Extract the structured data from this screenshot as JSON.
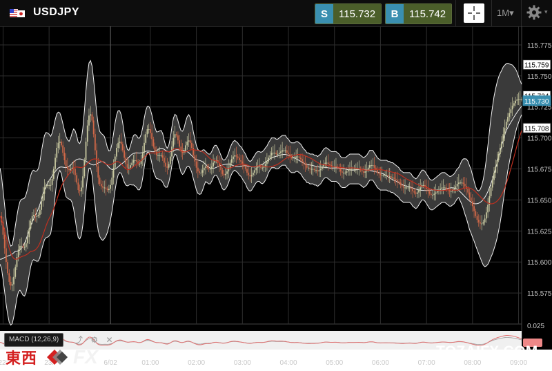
{
  "header": {
    "symbol": "USDJPY",
    "sell": {
      "label": "S",
      "price": "115.732"
    },
    "buy": {
      "label": "B",
      "price": "115.742"
    },
    "timeframe": "1M",
    "timeframe_caret": "▾"
  },
  "macd": {
    "label": "MACD (12,26,9)",
    "tools": [
      "⤴",
      "⚙",
      "✕"
    ],
    "axis_label": "0.025"
  },
  "watermark": {
    "left_cjk": "東西",
    "left_fx": "FX",
    "right": "TOZAIFX.COM"
  },
  "price_tags": [
    {
      "text": "115.759",
      "value": 115.759,
      "style": "white"
    },
    {
      "text": "115.734",
      "value": 115.734,
      "style": "white"
    },
    {
      "text": "115.730",
      "value": 115.73,
      "style": "blue"
    },
    {
      "text": "115.708",
      "value": 115.708,
      "style": "white"
    }
  ],
  "colors": {
    "background": "#000000",
    "grid": "#2e2e2e",
    "band_fill": "#3a3a3a",
    "band_line": "#f2f2f2",
    "candle_up": "#c8c8a0",
    "candle_down": "#d06848",
    "ma_line": "#c03020",
    "sell_tag": "#3a8fb0",
    "price_bg": "#4b5e2a",
    "macd_bg": "#f0f0f0",
    "macd_line": "#e07070"
  },
  "chart_data": {
    "type": "line",
    "ylim": [
      115.55,
      115.79
    ],
    "y_ticks": [
      "115.775",
      "115.750",
      "115.725",
      "115.700",
      "115.675",
      "115.650",
      "115.625",
      "115.600",
      "115.575"
    ],
    "x_ticks": [
      "22:",
      "23:",
      "6/02",
      "01:00",
      "02:00",
      "03:00",
      "04:00",
      "05:00",
      "06:00",
      "07:00",
      "08:00",
      "09:00"
    ],
    "x_tick_index": [
      2,
      32,
      72,
      98,
      128,
      158,
      188,
      218,
      248,
      278,
      308,
      338
    ],
    "series": [
      {
        "values": [
          115.637,
          115.632,
          115.622,
          115.611,
          115.6,
          115.591,
          115.584,
          115.581,
          115.582,
          115.588,
          115.596,
          115.604,
          115.61,
          115.613,
          115.613,
          115.612,
          115.612,
          115.615,
          115.62,
          115.627,
          115.633,
          115.637,
          115.638,
          115.637,
          115.637,
          115.638,
          115.642,
          115.649,
          115.655,
          115.66,
          115.662,
          115.662,
          115.662,
          115.662,
          115.667,
          115.675,
          115.684,
          115.692,
          115.696,
          115.697,
          115.694,
          115.688,
          115.682,
          115.677,
          115.675,
          115.674,
          115.675,
          115.676,
          115.675,
          115.67,
          115.664,
          115.658,
          115.657,
          115.66,
          115.669,
          115.682,
          115.697,
          115.71,
          115.718,
          115.719,
          115.714,
          115.703,
          115.69,
          115.677,
          115.668,
          115.663,
          115.661,
          115.66,
          115.66,
          115.659,
          115.658,
          115.659,
          115.662,
          115.668,
          115.676,
          115.685,
          115.692,
          115.696,
          115.697,
          115.695,
          115.69,
          115.684,
          115.679,
          115.676,
          115.676,
          115.678,
          115.68,
          115.682,
          115.682,
          115.681,
          115.679,
          115.679,
          115.682,
          115.688,
          115.696,
          115.703,
          115.707,
          115.707,
          115.704,
          115.699,
          115.693,
          115.689,
          115.686,
          115.686,
          115.686,
          115.686,
          115.684,
          115.68,
          115.677,
          115.676,
          115.679,
          115.685,
          115.693,
          115.7,
          115.703,
          115.702,
          115.698,
          115.693,
          115.689,
          115.688,
          115.69,
          115.694,
          115.697,
          115.698,
          115.696,
          115.692,
          115.686,
          115.681,
          115.676,
          115.673,
          115.672,
          115.672,
          115.674,
          115.676,
          115.677,
          115.676,
          115.675,
          115.675,
          115.677,
          115.68,
          115.682,
          115.682,
          115.68,
          115.677,
          115.674,
          115.671,
          115.67,
          115.671,
          115.673,
          115.676,
          115.68,
          115.683,
          115.685,
          115.686,
          115.685,
          115.684,
          115.682,
          115.681,
          115.679,
          115.677,
          115.675,
          115.672,
          115.67,
          115.669,
          115.67,
          115.672,
          115.674,
          115.676,
          115.677,
          115.677,
          115.676,
          115.676,
          115.677,
          115.679,
          115.681,
          115.684,
          115.686,
          115.688,
          115.688,
          115.688,
          115.687,
          115.687,
          115.688,
          115.689,
          115.69,
          115.69,
          115.69,
          115.688,
          115.687,
          115.685,
          115.684,
          115.684,
          115.684,
          115.685,
          115.685,
          115.684,
          115.683,
          115.681,
          115.679,
          115.678,
          115.676,
          115.676,
          115.675,
          115.675,
          115.675,
          115.674,
          115.674,
          115.673,
          115.674,
          115.675,
          115.677,
          115.679,
          115.68,
          115.68,
          115.679,
          115.678,
          115.677,
          115.677,
          115.677,
          115.677,
          115.676,
          115.675,
          115.673,
          115.672,
          115.672,
          115.672,
          115.673,
          115.674,
          115.675,
          115.675,
          115.675,
          115.675,
          115.675,
          115.675,
          115.675,
          115.674,
          115.673,
          115.672,
          115.673,
          115.674,
          115.676,
          115.678,
          115.678,
          115.678,
          115.676,
          115.674,
          115.672,
          115.671,
          115.67,
          115.67,
          115.67,
          115.67,
          115.67,
          115.669,
          115.669,
          115.668,
          115.668,
          115.667,
          115.666,
          115.665,
          115.664,
          115.662,
          115.661,
          115.66,
          115.66,
          115.66,
          115.66,
          115.66,
          115.659,
          115.657,
          115.656,
          115.655,
          115.656,
          115.658,
          115.66,
          115.662,
          115.662,
          115.661,
          115.659,
          115.657,
          115.655,
          115.654,
          115.654,
          115.655,
          115.656,
          115.657,
          115.658,
          115.659,
          115.66,
          115.66,
          115.66,
          115.659,
          115.658,
          115.657,
          115.657,
          115.658,
          115.659,
          115.661,
          115.663,
          115.664,
          115.664,
          115.664,
          115.663,
          115.661,
          115.659,
          115.656,
          115.652,
          115.649,
          115.645,
          115.641,
          115.637,
          115.634,
          115.632,
          115.631,
          115.631,
          115.632,
          115.635,
          115.64,
          115.646,
          115.653,
          115.66,
          115.666,
          115.672,
          115.677,
          115.682,
          115.687,
          115.692,
          115.697,
          115.703,
          115.708,
          115.713,
          115.717,
          115.72,
          115.723,
          115.726,
          115.728,
          115.73,
          115.731,
          115.731,
          115.731,
          115.731
        ]
      }
    ]
  }
}
